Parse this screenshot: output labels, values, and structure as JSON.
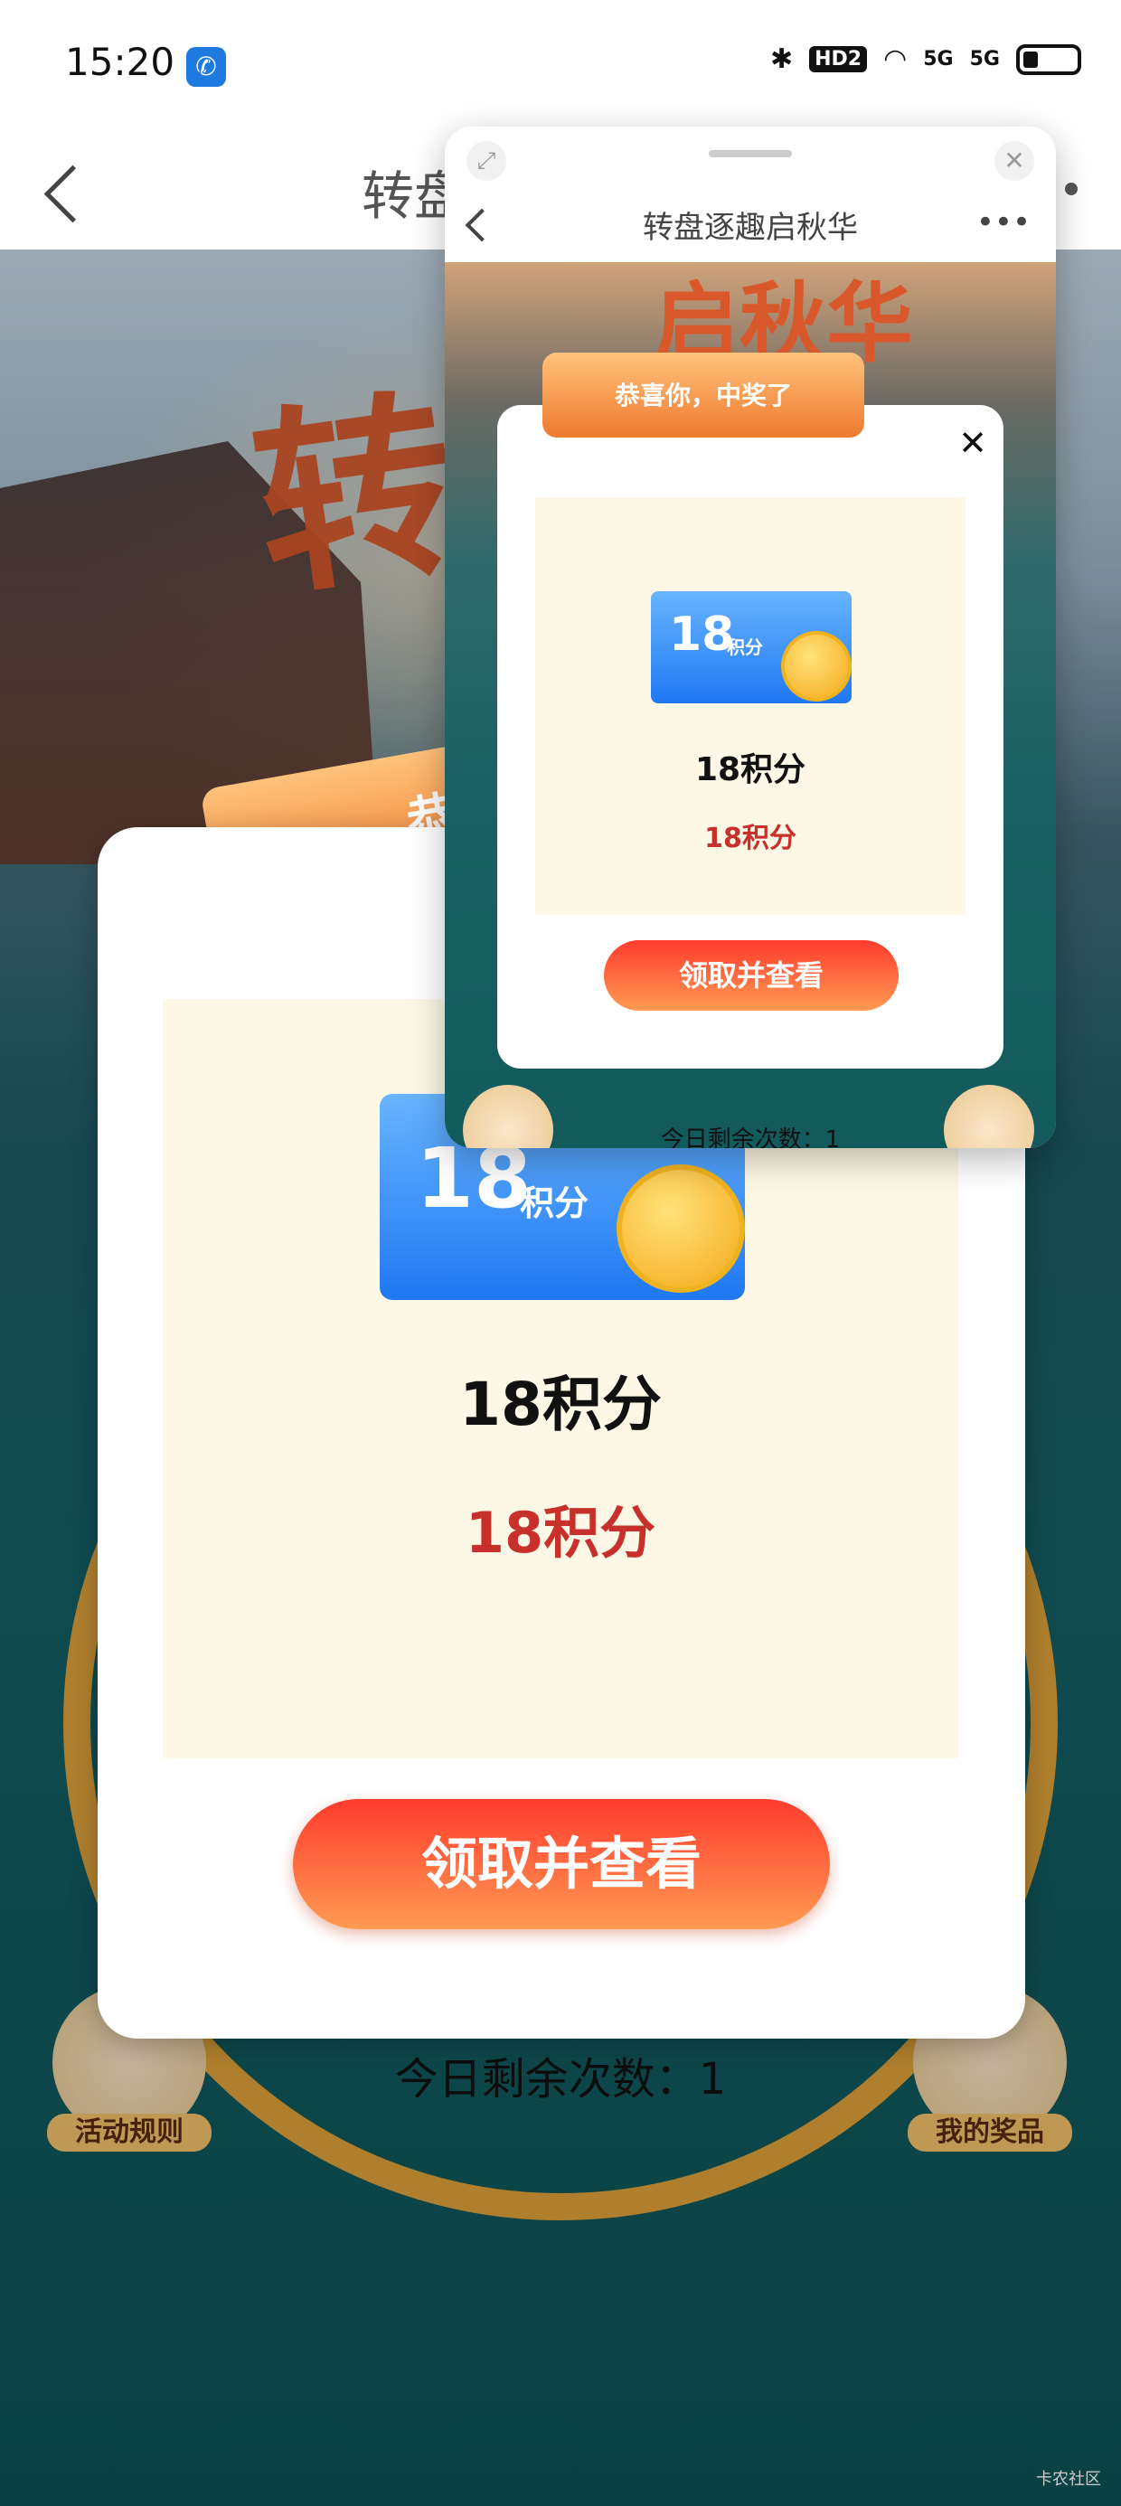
{
  "status_bar": {
    "time": "15:20",
    "call_icon": "phone-icon",
    "icons": [
      "bluetooth-icon",
      "hd-voice-icon",
      "wifi-icon",
      "5g-signal-icon",
      "5g-signal-icon",
      "battery-icon"
    ],
    "hd_label": "HD2",
    "sig1_label": "5G",
    "sig2_label": "5G"
  },
  "header": {
    "title": "转盘"
  },
  "background": {
    "scene_title": "转启",
    "remaining_text": "今日剩余次数：1",
    "rules_label": "活动规则",
    "prizes_label": "我的奖品"
  },
  "big_modal": {
    "ribbon_text": "恭",
    "badge_number": "18",
    "badge_unit": "积分",
    "prize_name": "18积分",
    "prize_value": "18积分",
    "claim_button": "领取并查看"
  },
  "mini_window": {
    "title": "转盘逐趣启秋华",
    "scene_title": "启秋华",
    "ribbon_text": "恭喜你，中奖了",
    "badge_number": "18",
    "badge_unit": "积分",
    "prize_name": "18积分",
    "prize_value": "18积分",
    "claim_button": "领取并查看",
    "remaining_text": "今日剩余次数：1"
  },
  "watermark": "卡农社区",
  "colors": {
    "accent_red": "#c8302b",
    "claim_gradient_start": "#ff3b2e",
    "claim_gradient_end": "#ff9b52",
    "badge_blue": "#1f78f2",
    "card_bg": "#fdf8e6"
  }
}
